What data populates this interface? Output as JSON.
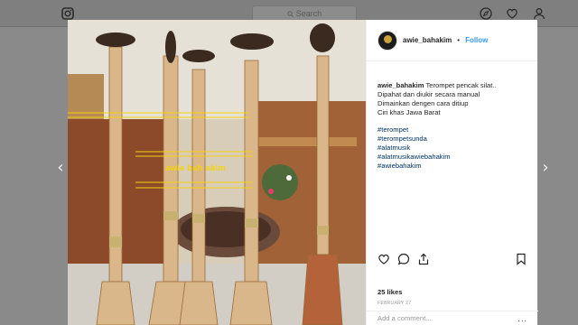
{
  "nav": {
    "search_placeholder": "Search",
    "icons": [
      "instagram-logo-icon",
      "search-icon",
      "compass-icon",
      "heart-icon",
      "user-icon"
    ]
  },
  "photo": {
    "watermark": "awie bah akim",
    "colors": {
      "watermark": "#f4d20c"
    }
  },
  "post": {
    "username": "awie_bahakim",
    "separator": "•",
    "follow_label": "Follow",
    "caption": {
      "username": "awie_bahakim",
      "lines": [
        "Terompet pencak silat..",
        "Dipahat dan diukir secara manual",
        "Dimainkan dengen cara ditiup",
        "Ciri khas Jawa Barat"
      ]
    },
    "hashtags": [
      "#terompet",
      "#terompetsunda",
      "#alatmusik",
      "#alatmusikawiebahakim",
      "#awiebahakim"
    ],
    "likes": "25 likes",
    "date": "FEBRUARY 27",
    "comment_placeholder": "Add a comment...",
    "more_label": "...",
    "colors": {
      "link": "#3897f0",
      "hashtag": "#003569"
    }
  },
  "navigation": {
    "prev": "‹",
    "next": "›"
  }
}
